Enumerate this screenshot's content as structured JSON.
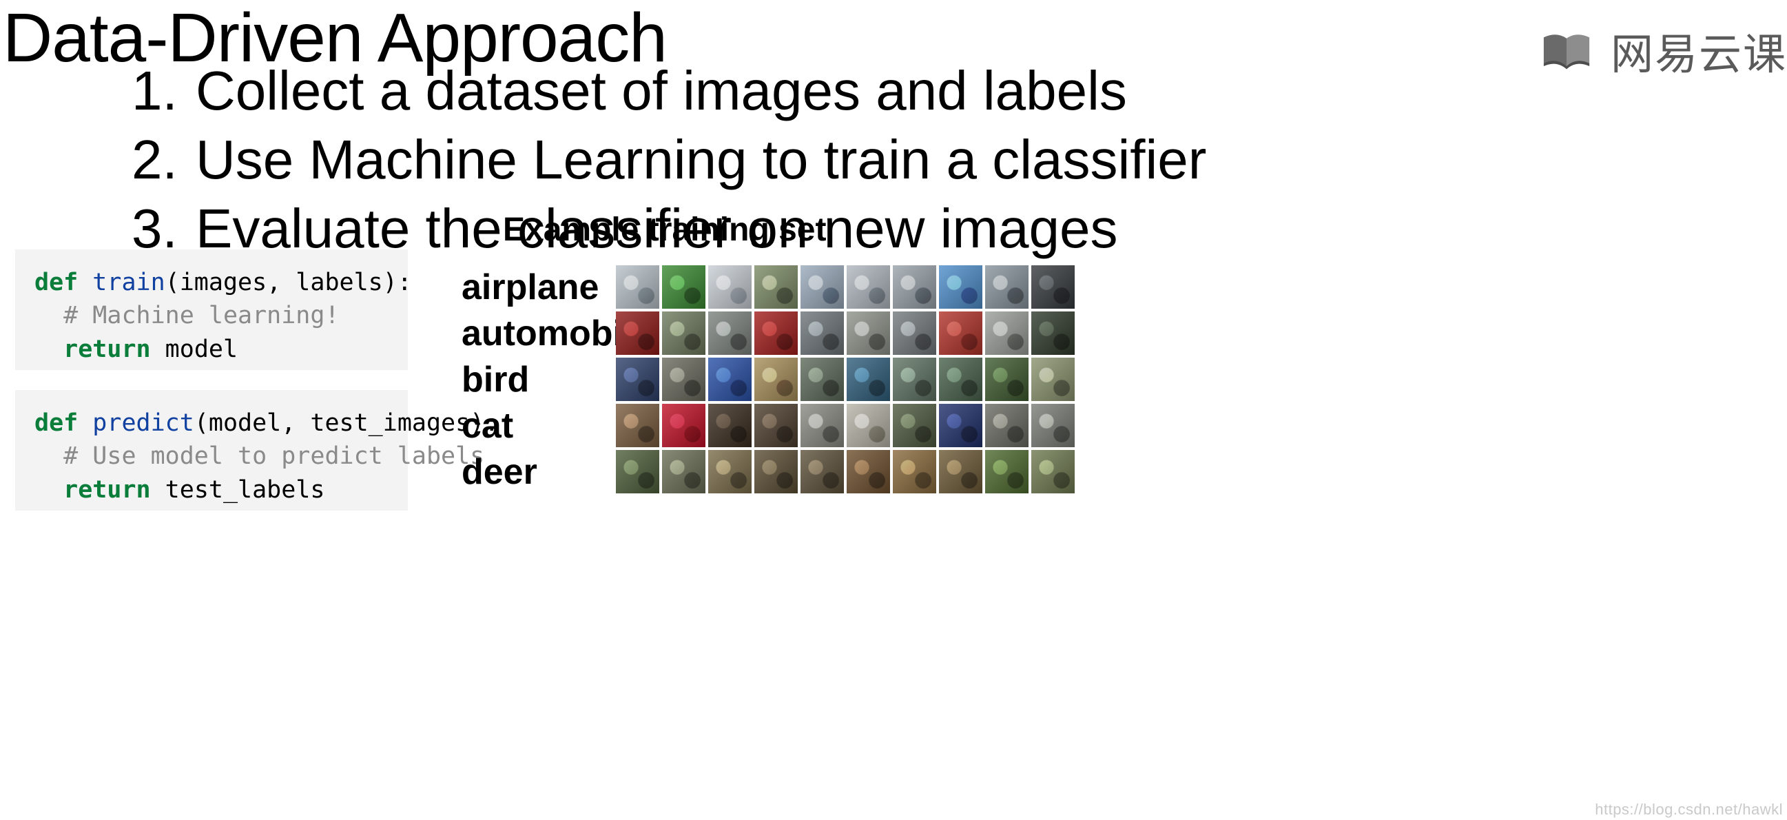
{
  "title": "Data-Driven Approach",
  "steps": [
    "Collect a dataset of images and labels",
    "Use Machine Learning to train a classifier",
    "Evaluate the classifier on new images"
  ],
  "brand": {
    "text": "网易云课"
  },
  "example_heading": "Example training set",
  "code": {
    "train": {
      "kw_def": "def",
      "fn": "train",
      "args": "(images, labels):",
      "comment": "# Machine learning!",
      "kw_ret": "return",
      "ret_val": "model"
    },
    "predict": {
      "kw_def": "def",
      "fn": "predict",
      "args": "(model, test_images):",
      "comment": "# Use model to predict labels",
      "kw_ret": "return",
      "ret_val": "test_labels"
    }
  },
  "classes": [
    "airplane",
    "automobile",
    "bird",
    "cat",
    "deer"
  ],
  "thumbs_per_row": 10,
  "thumb_palettes": [
    [
      "#b8c2c9",
      "#3a8a32",
      "#c9cfd6",
      "#7d8c66",
      "#9aaabb",
      "#b0b8bf",
      "#9aa3aa",
      "#4e8ecb",
      "#87949c",
      "#353a3e"
    ],
    [
      "#8f1a17",
      "#6e7a5d",
      "#7c837f",
      "#a21d1b",
      "#6d7579",
      "#8e938a",
      "#73797c",
      "#b23229",
      "#9a9e98",
      "#2f3a2b"
    ],
    [
      "#2d3f6a",
      "#6a6a5e",
      "#2850a8",
      "#a88f5a",
      "#5d6a5a",
      "#2f5f7d",
      "#5f7363",
      "#49624c",
      "#3e5b2f",
      "#8a946e"
    ],
    [
      "#7a5c3e",
      "#c21026",
      "#3a2c1e",
      "#4d3e2d",
      "#8a8a82",
      "#b8b4a8",
      "#4e5a3f",
      "#1f2f6b",
      "#6b6b63",
      "#7a7e76"
    ],
    [
      "#4e5f3a",
      "#6a6f55",
      "#7b6d4a",
      "#5a4d33",
      "#5e513a",
      "#6e4f2d",
      "#8a6a3c",
      "#6d5a36",
      "#4e6a2e",
      "#6e7a4f"
    ]
  ],
  "footer_watermark": "https://blog.csdn.net/hawkl"
}
